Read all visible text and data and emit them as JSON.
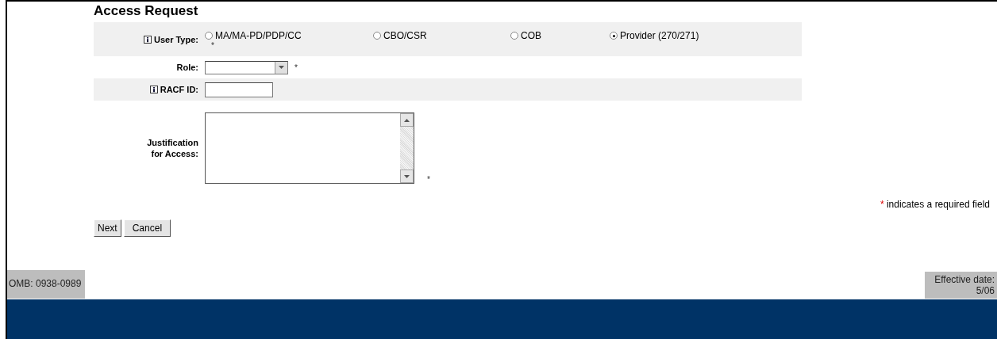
{
  "title": "Access Request",
  "user_type": {
    "label": "User Type:",
    "required_mark": "*",
    "options": [
      {
        "label": "MA/MA-PD/PDP/CC",
        "selected": false
      },
      {
        "label": "CBO/CSR",
        "selected": false
      },
      {
        "label": "COB",
        "selected": false
      },
      {
        "label": "Provider (270/271)",
        "selected": true
      }
    ]
  },
  "role": {
    "label": "Role:",
    "required_mark": "*"
  },
  "racf_id": {
    "label": "RACF ID:"
  },
  "justification": {
    "label": "Justification for Access:",
    "required_mark": "*"
  },
  "legend": {
    "mark": "*",
    "text": "indicates a required field"
  },
  "buttons": [
    "Next",
    "Cancel"
  ],
  "footer": {
    "omb": "OMB: 0938-0989",
    "effective_date": "Effective date: 5/06"
  }
}
